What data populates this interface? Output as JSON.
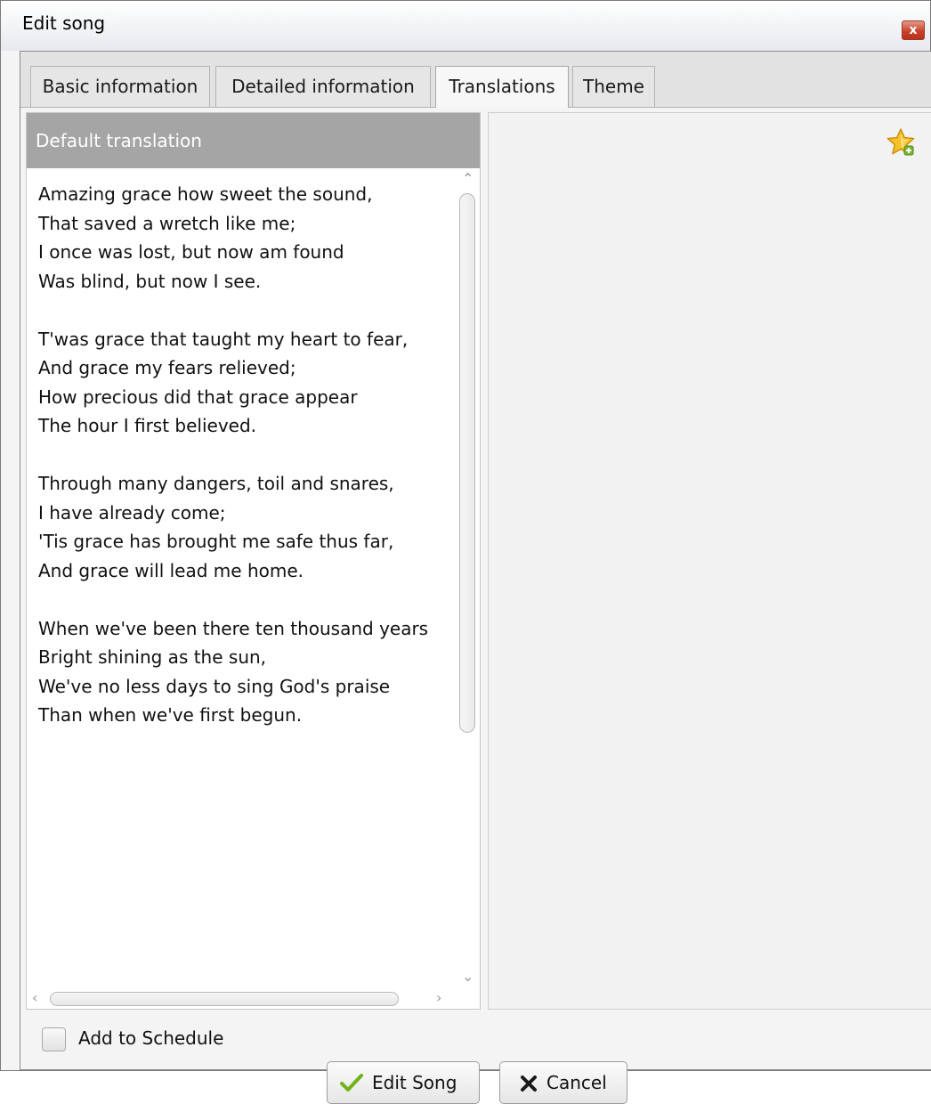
{
  "window": {
    "title": "Edit song",
    "close_glyph": "x"
  },
  "tabs": [
    {
      "label": "Basic information"
    },
    {
      "label": "Detailed information"
    },
    {
      "label": "Translations",
      "active": true
    },
    {
      "label": "Theme"
    }
  ],
  "left_pane": {
    "header": "Default translation",
    "lyrics": "Amazing grace how sweet the sound,\nThat saved a wretch like me;\nI once was lost, but now am found\nWas blind, but now I see.\n\nT'was grace that taught my heart to fear,\nAnd grace my fears relieved;\nHow precious did that grace appear\nThe hour I first believed.\n\nThrough many dangers, toil and snares,\nI have already come;\n'Tis grace has brought me safe thus far,\nAnd grace will lead me home.\n\nWhen we've been there ten thousand years\nBright shining as the sun,\nWe've no less days to sing God's praise\nThan when we've first begun."
  },
  "right_pane": {
    "icon": "star-icon",
    "star_color": "#f0b400"
  },
  "bottom": {
    "add_to_schedule_label": "Add to Schedule",
    "add_to_schedule_checked": false,
    "edit_button_label": "Edit Song",
    "cancel_button_label": "Cancel"
  },
  "colors": {
    "header_bg": "#a5a5a5",
    "checkmark": "#6fb31b",
    "close_button": "#c9432a"
  }
}
